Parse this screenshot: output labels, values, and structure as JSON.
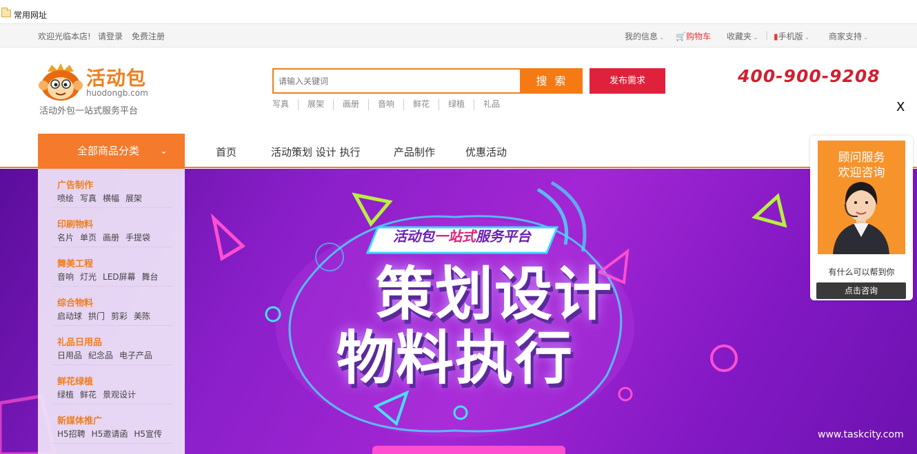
{
  "bookmarks": {
    "folder_label": "常用网址"
  },
  "topbar": {
    "welcome": "欢迎光临本店!",
    "login": "请登录",
    "register": "免费注册",
    "my_info": "我的信息",
    "cart": "购物车",
    "favorites": "收藏夹",
    "mobile": "手机版",
    "merchant": "商家支持"
  },
  "header": {
    "logo_text": "活动包",
    "logo_sub": "huodongb.com",
    "slogan": "活动外包一站式服务平台",
    "search_placeholder": "请输入关键词",
    "search_button": "搜 索",
    "publish_button": "发布需求",
    "hotwords": [
      "写真",
      "展架",
      "画册",
      "音响",
      "鲜花",
      "绿植",
      "礼品"
    ],
    "phone": "400-900-9208",
    "close": "X"
  },
  "nav": {
    "all_categories": "全部商品分类",
    "items": [
      "首页",
      "活动策划 设计 执行",
      "产品制作",
      "优惠活动"
    ]
  },
  "categories": [
    {
      "title": "广告制作",
      "subs": [
        "喷绘",
        "写真",
        "横幅",
        "展架"
      ]
    },
    {
      "title": "印刷物料",
      "subs": [
        "名片",
        "单页",
        "画册",
        "手提袋"
      ]
    },
    {
      "title": "舞美工程",
      "subs": [
        "音响",
        "灯光",
        "LED屏幕",
        "舞台"
      ]
    },
    {
      "title": "综合物料",
      "subs": [
        "启动球",
        "拱门",
        "剪彩",
        "美陈"
      ]
    },
    {
      "title": "礼品日用品",
      "subs": [
        "日用品",
        "纪念品",
        "电子产品"
      ]
    },
    {
      "title": "鲜花绿植",
      "subs": [
        "绿植",
        "鲜花",
        "景观设计"
      ]
    },
    {
      "title": "新媒体推广",
      "subs": [
        "H5招聘",
        "H5邀请函",
        "H5宣传"
      ]
    }
  ],
  "banner": {
    "tag_prefix": "活动包",
    "tag_highlight": "一站式",
    "tag_suffix": "服务平台",
    "line1": "策划设计",
    "line2": "物料执行",
    "watermark": "www.taskcity.com"
  },
  "consult": {
    "title_line1": "顾问服务",
    "title_line2": "欢迎咨询",
    "question": "有什么可以帮到你",
    "button": "点击咨询"
  },
  "colors": {
    "brand_orange": "#f57a13",
    "publish_red": "#e0213b",
    "phone_red": "#d02030",
    "banner_purple": "#8a1fc9"
  }
}
